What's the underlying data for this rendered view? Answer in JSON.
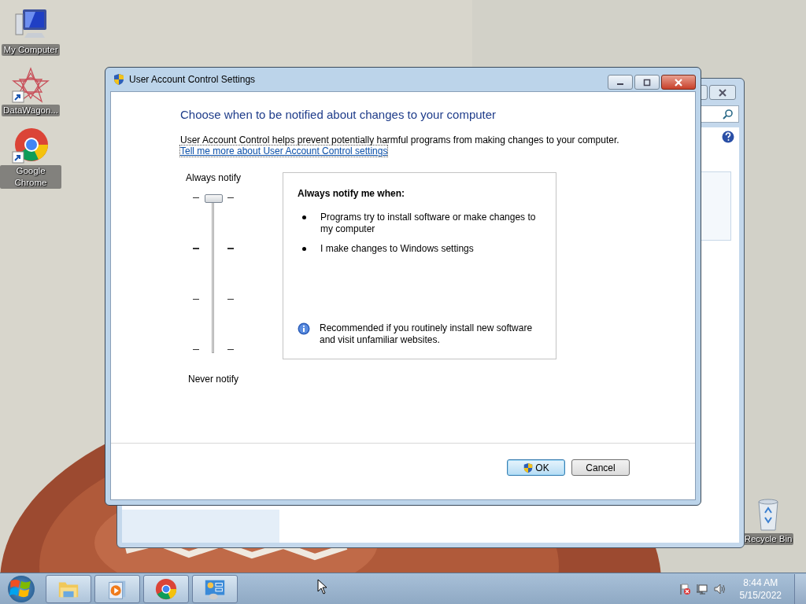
{
  "desktop_icons": [
    {
      "label": "My Computer",
      "kind": "computer",
      "shortcut": false
    },
    {
      "label": "DataWagon...",
      "kind": "datawagon",
      "shortcut": true
    },
    {
      "label": "Google Chrome",
      "kind": "chrome",
      "shortcut": true
    }
  ],
  "recycle_bin": {
    "label": "Recycle Bin"
  },
  "dialog": {
    "title": "User Account Control Settings",
    "heading": "Choose when to be notified about changes to your computer",
    "description": "User Account Control helps prevent potentially harmful programs from making changes to your computer.",
    "link": "Tell me more about User Account Control settings",
    "slider": {
      "top_label": "Always notify",
      "bottom_label": "Never notify",
      "level": 1
    },
    "panel": {
      "title": "Always notify me when:",
      "bullets": [
        "Programs try to install software or make changes to my computer",
        "I make changes to Windows settings"
      ],
      "note": "Recommended if you routinely install new software and visit unfamiliar websites."
    },
    "buttons": [
      {
        "label": "OK",
        "default": true,
        "shield": true
      },
      {
        "label": "Cancel",
        "default": false,
        "shield": false
      }
    ]
  },
  "taskbar": {
    "items": [
      {
        "kind": "explorer"
      },
      {
        "kind": "media"
      },
      {
        "kind": "chrome"
      },
      {
        "kind": "control"
      }
    ],
    "time": "8:44 AM",
    "date": "5/15/2022"
  }
}
